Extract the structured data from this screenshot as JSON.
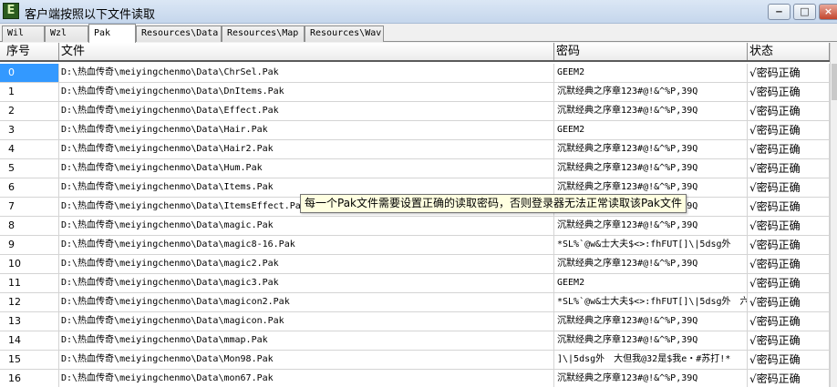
{
  "window": {
    "icon_letter": "E",
    "title": "客户端按照以下文件读取",
    "minimize": "‒",
    "maximize": "□",
    "close": "×"
  },
  "tabs": [
    {
      "label": "Wil",
      "active": false
    },
    {
      "label": "Wzl",
      "active": false
    },
    {
      "label": "Pak",
      "active": true
    },
    {
      "label": "Resources\\Data",
      "active": false
    },
    {
      "label": "Resources\\Map",
      "active": false
    },
    {
      "label": "Resources\\Wav",
      "active": false
    }
  ],
  "columns": {
    "index": "序号",
    "file": "文件",
    "password": "密码",
    "status": "状态"
  },
  "rows": [
    {
      "index": "0",
      "file": "D:\\热血传奇\\meiyingchenmo\\Data\\ChrSel.Pak",
      "password": "GEEM2",
      "status": "√密码正确"
    },
    {
      "index": "1",
      "file": "D:\\热血传奇\\meiyingchenmo\\Data\\DnItems.Pak",
      "password": "沉默经典之序章123#@!&^%P,39Q",
      "status": "√密码正确"
    },
    {
      "index": "2",
      "file": "D:\\热血传奇\\meiyingchenmo\\Data\\Effect.Pak",
      "password": "沉默经典之序章123#@!&^%P,39Q",
      "status": "√密码正确"
    },
    {
      "index": "3",
      "file": "D:\\热血传奇\\meiyingchenmo\\Data\\Hair.Pak",
      "password": "GEEM2",
      "status": "√密码正确"
    },
    {
      "index": "4",
      "file": "D:\\热血传奇\\meiyingchenmo\\Data\\Hair2.Pak",
      "password": "沉默经典之序章123#@!&^%P,39Q",
      "status": "√密码正确"
    },
    {
      "index": "5",
      "file": "D:\\热血传奇\\meiyingchenmo\\Data\\Hum.Pak",
      "password": "沉默经典之序章123#@!&^%P,39Q",
      "status": "√密码正确"
    },
    {
      "index": "6",
      "file": "D:\\热血传奇\\meiyingchenmo\\Data\\Items.Pak",
      "password": "沉默经典之序章123#@!&^%P,39Q",
      "status": "√密码正确"
    },
    {
      "index": "7",
      "file": "D:\\热血传奇\\meiyingchenmo\\Data\\ItemsEffect.Pak",
      "password": "沉默经典之序章123#@!&^%P,39Q",
      "status": "√密码正确"
    },
    {
      "index": "8",
      "file": "D:\\热血传奇\\meiyingchenmo\\Data\\magic.Pak",
      "password": "沉默经典之序章123#@!&^%P,39Q",
      "status": "√密码正确"
    },
    {
      "index": "9",
      "file": "D:\\热血传奇\\meiyingchenmo\\Data\\magic8-16.Pak",
      "password": "*SL%`@w&士大夫$<>:fhFUT[]\\|5dsg外",
      "status": "√密码正确"
    },
    {
      "index": "10",
      "file": "D:\\热血传奇\\meiyingchenmo\\Data\\magic2.Pak",
      "password": "沉默经典之序章123#@!&^%P,39Q",
      "status": "√密码正确"
    },
    {
      "index": "11",
      "file": "D:\\热血传奇\\meiyingchenmo\\Data\\magic3.Pak",
      "password": "GEEM2",
      "status": "√密码正确"
    },
    {
      "index": "12",
      "file": "D:\\热血传奇\\meiyingchenmo\\Data\\magicon2.Pak",
      "password": "*SL%`@w&士大夫$<>:fhFUT[]\\|5dsg外　六",
      "status": "√密码正确"
    },
    {
      "index": "13",
      "file": "D:\\热血传奇\\meiyingchenmo\\Data\\magicon.Pak",
      "password": "沉默经典之序章123#@!&^%P,39Q",
      "status": "√密码正确"
    },
    {
      "index": "14",
      "file": "D:\\热血传奇\\meiyingchenmo\\Data\\mmap.Pak",
      "password": "沉默经典之序章123#@!&^%P,39Q",
      "status": "√密码正确"
    },
    {
      "index": "15",
      "file": "D:\\热血传奇\\meiyingchenmo\\Data\\Mon98.Pak",
      "password": "]\\|5dsg外　大但我@32是$我e・#苏打!*",
      "status": "√密码正确"
    },
    {
      "index": "16",
      "file": "D:\\热血传奇\\meiyingchenmo\\Data\\mon67.Pak",
      "password": "沉默经典之序章123#@!&^%P,39Q",
      "status": "√密码正确"
    }
  ],
  "tooltip": "每一个Pak文件需要设置正确的读取密码，否则登录器无法正常读取该Pak文件",
  "colors": {
    "selection": "#3399ff",
    "tooltip_bg": "#ffffe1",
    "titlebar": "#c5d6ec"
  }
}
